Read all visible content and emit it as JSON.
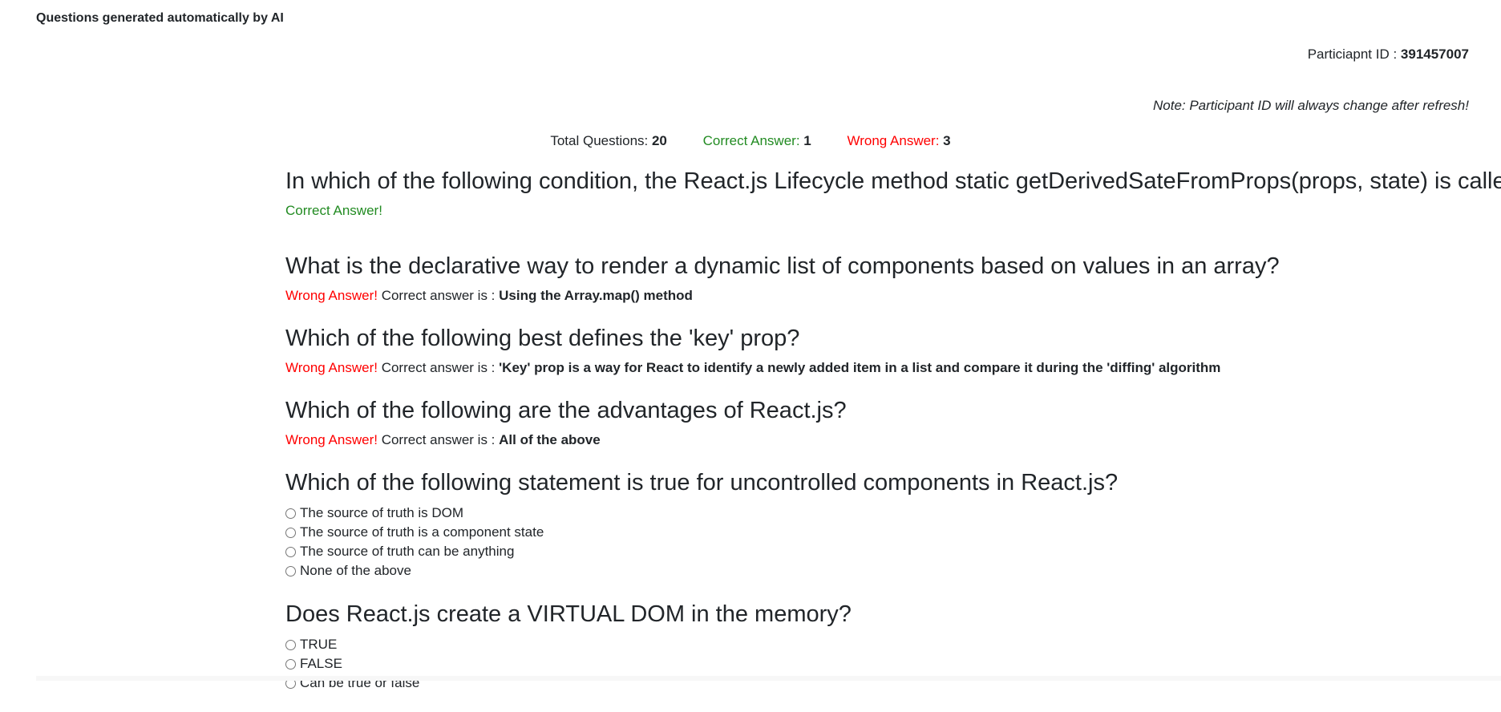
{
  "header": {
    "title": "Questions generated automatically by AI"
  },
  "participant": {
    "label": "Particiapnt ID : ",
    "id": "391457007"
  },
  "note": "Note: Participant ID will always change after refresh!",
  "stats": {
    "total_label": "Total Questions: ",
    "total_value": "20",
    "correct_label": "Correct Answer: ",
    "correct_value": "1",
    "wrong_label": "Wrong Answer: ",
    "wrong_value": "3"
  },
  "colors": {
    "correct": "#228b22",
    "wrong": "#ff0000"
  },
  "questions": [
    {
      "title": "In which of the following condition, the React.js Lifecycle method static getDerivedSateFromProps(props, state) is called?",
      "status": "Correct Answer!"
    },
    {
      "title": "What is the declarative way to render a dynamic list of components based on values in an array?",
      "status": "Wrong Answer!",
      "correct_prefix": " Correct answer is : ",
      "correct_answer": "Using the Array.map() method"
    },
    {
      "title": "Which of the following best defines the 'key' prop?",
      "status": "Wrong Answer!",
      "correct_prefix": " Correct answer is : ",
      "correct_answer": "'Key' prop is a way for React to identify a newly added item in a list and compare it during the 'diffing' algorithm"
    },
    {
      "title": "Which of the following are the advantages of React.js?",
      "status": "Wrong Answer!",
      "correct_prefix": " Correct answer is : ",
      "correct_answer": "All of the above"
    },
    {
      "title": "Which of the following statement is true for uncontrolled components in React.js?",
      "options": [
        "The source of truth is DOM",
        "The source of truth is a component state",
        "The source of truth can be anything",
        "None of the above"
      ]
    },
    {
      "title": "Does React.js create a VIRTUAL DOM in the memory?",
      "options": [
        "TRUE",
        "FALSE",
        "Can be true or false"
      ]
    }
  ]
}
